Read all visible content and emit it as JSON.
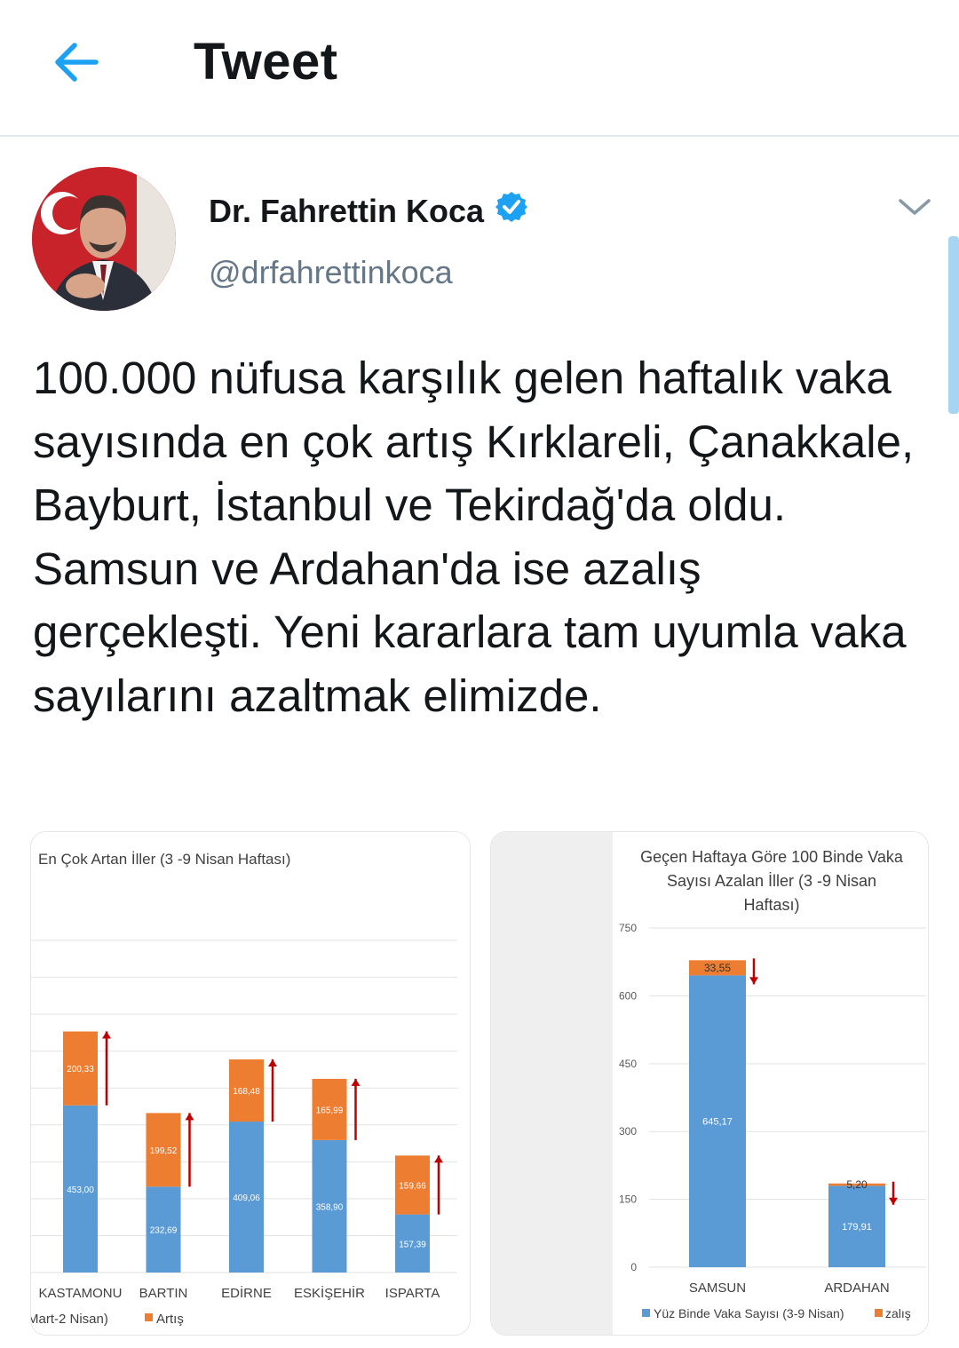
{
  "header": {
    "title": "Tweet"
  },
  "user": {
    "name": "Dr. Fahrettin Koca",
    "handle": "@drfahrettinkoca"
  },
  "tweet": {
    "text": "100.000 nüfusa karşılık gelen haftalık vaka sayısında en çok artış Kırklareli, Çanakkale, Bayburt, İstanbul ve Tekirdağ'da oldu. Samsun ve Ardahan'da ise azalış gerçekleşti. Yeni kararlara tam uyumla vaka sayılarını azaltmak elimizde."
  },
  "chart_data": [
    {
      "type": "bar",
      "title": "En Çok Artan İller (3 -9 Nisan Haftası)",
      "categories": [
        "KASTAMONU",
        "BARTIN",
        "EDİRNE",
        "ESKİŞEHİR",
        "ISPARTA"
      ],
      "series": [
        {
          "name": "",
          "values": [
            453.0,
            232.69,
            409.06,
            358.9,
            157.39
          ],
          "labels": [
            "453,00",
            "232,69",
            "409,06",
            "358,90",
            "157,39"
          ],
          "color": "#5b9bd5"
        },
        {
          "name": "Artış",
          "values": [
            200.33,
            199.52,
            168.48,
            165.99,
            159.66
          ],
          "labels": [
            "200,33",
            "199,52",
            "168,48",
            "165,99",
            "159,66"
          ],
          "color": "#ed7d31"
        }
      ],
      "legend_text": "Mart-2 Nisan)",
      "stacked": true,
      "ylim": [
        0,
        900
      ],
      "grid": true,
      "arrow_color": "#c00000",
      "arrow_direction": "up"
    },
    {
      "type": "bar",
      "title": "Geçen Haftaya Göre 100 Binde Vaka Sayısı Azalan İller (3 -9 Nisan Haftası)",
      "categories": [
        "SAMSUN",
        "ARDAHAN"
      ],
      "series": [
        {
          "name": "Yüz Binde Vaka Sayısı (3-9 Nisan)",
          "values": [
            645.17,
            179.91
          ],
          "labels": [
            "645,17",
            "179,91"
          ],
          "color": "#5b9bd5"
        },
        {
          "name": "zalış",
          "values": [
            33.55,
            5.2
          ],
          "labels": [
            "33,55",
            "5,20"
          ],
          "color": "#ed7d31"
        }
      ],
      "stacked": true,
      "ylim": [
        0,
        750
      ],
      "yticks": [
        0,
        150,
        300,
        450,
        600,
        750
      ],
      "grid": true,
      "arrow_color": "#c00000",
      "arrow_direction": "down"
    }
  ]
}
